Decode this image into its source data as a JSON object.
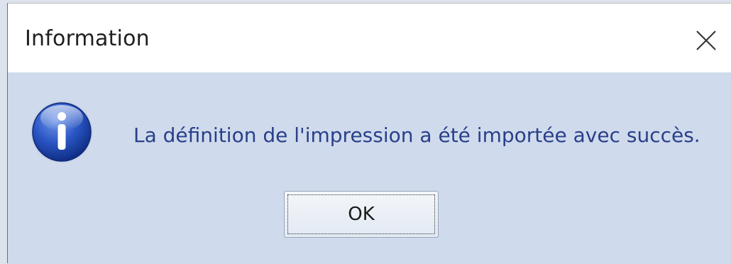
{
  "dialog": {
    "title": "Information",
    "message": "La définition de l'impression a été importée avec succès.",
    "ok_label": "OK",
    "close_icon": "close-icon",
    "info_icon": "information-icon"
  }
}
